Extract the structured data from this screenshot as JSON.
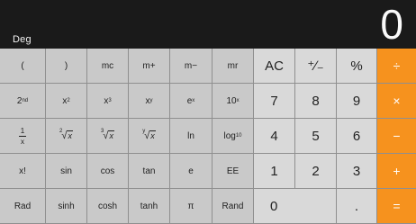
{
  "display": {
    "mode": "Deg",
    "value": "0"
  },
  "rows": [
    [
      {
        "id": "open-paren",
        "label": "(",
        "kind": "sci"
      },
      {
        "id": "close-paren",
        "label": ")",
        "kind": "sci"
      },
      {
        "id": "mc",
        "label": "mc",
        "kind": "sci"
      },
      {
        "id": "m-plus",
        "label": "m+",
        "kind": "sci"
      },
      {
        "id": "m-minus",
        "label": "m−",
        "kind": "sci"
      },
      {
        "id": "mr",
        "label": "mr",
        "kind": "sci"
      },
      {
        "id": "ac",
        "label": "AC",
        "kind": "num"
      },
      {
        "id": "plus-minus",
        "label": "⁺∕₋",
        "kind": "num"
      },
      {
        "id": "percent",
        "label": "%",
        "kind": "num"
      },
      {
        "id": "divide",
        "label": "÷",
        "kind": "op"
      }
    ],
    [
      {
        "id": "second",
        "label": "2",
        "sup": "nd",
        "kind": "sci"
      },
      {
        "id": "x-squared",
        "label": "x",
        "sup": "2",
        "kind": "sci"
      },
      {
        "id": "x-cubed",
        "label": "x",
        "sup": "3",
        "kind": "sci"
      },
      {
        "id": "x-pow-y",
        "label": "x",
        "sup": "y",
        "kind": "sci"
      },
      {
        "id": "e-pow-x",
        "label": "e",
        "sup": "x",
        "kind": "sci"
      },
      {
        "id": "ten-pow-x",
        "label": "10",
        "sup": "x",
        "kind": "sci"
      },
      {
        "id": "digit-7",
        "label": "7",
        "kind": "num"
      },
      {
        "id": "digit-8",
        "label": "8",
        "kind": "num"
      },
      {
        "id": "digit-9",
        "label": "9",
        "kind": "num"
      },
      {
        "id": "multiply",
        "label": "×",
        "kind": "op"
      }
    ],
    [
      {
        "id": "reciprocal",
        "label": "",
        "kind": "sci",
        "frac": {
          "num": "1",
          "den": "x"
        }
      },
      {
        "id": "sqrt",
        "label": "",
        "kind": "sci",
        "rad": {
          "idx": "2",
          "arg": "x"
        }
      },
      {
        "id": "cbrt",
        "label": "",
        "kind": "sci",
        "rad": {
          "idx": "3",
          "arg": "x"
        }
      },
      {
        "id": "yroot",
        "label": "",
        "kind": "sci",
        "rad": {
          "idx": "y",
          "arg": "x"
        }
      },
      {
        "id": "ln",
        "label": "ln",
        "kind": "sci"
      },
      {
        "id": "log10",
        "label": "log",
        "sub": "10",
        "kind": "sci"
      },
      {
        "id": "digit-4",
        "label": "4",
        "kind": "num"
      },
      {
        "id": "digit-5",
        "label": "5",
        "kind": "num"
      },
      {
        "id": "digit-6",
        "label": "6",
        "kind": "num"
      },
      {
        "id": "subtract",
        "label": "−",
        "kind": "op"
      }
    ],
    [
      {
        "id": "factorial",
        "label": "x!",
        "kind": "sci"
      },
      {
        "id": "sin",
        "label": "sin",
        "kind": "sci"
      },
      {
        "id": "cos",
        "label": "cos",
        "kind": "sci"
      },
      {
        "id": "tan",
        "label": "tan",
        "kind": "sci"
      },
      {
        "id": "e-const",
        "label": "e",
        "kind": "sci"
      },
      {
        "id": "ee",
        "label": "EE",
        "kind": "sci"
      },
      {
        "id": "digit-1",
        "label": "1",
        "kind": "num"
      },
      {
        "id": "digit-2",
        "label": "2",
        "kind": "num"
      },
      {
        "id": "digit-3",
        "label": "3",
        "kind": "num"
      },
      {
        "id": "add",
        "label": "+",
        "kind": "op"
      }
    ],
    [
      {
        "id": "rad",
        "label": "Rad",
        "kind": "sci"
      },
      {
        "id": "sinh",
        "label": "sinh",
        "kind": "sci"
      },
      {
        "id": "cosh",
        "label": "cosh",
        "kind": "sci"
      },
      {
        "id": "tanh",
        "label": "tanh",
        "kind": "sci"
      },
      {
        "id": "pi",
        "label": "π",
        "kind": "sci"
      },
      {
        "id": "rand",
        "label": "Rand",
        "kind": "sci"
      },
      {
        "id": "digit-0",
        "label": "0",
        "kind": "num",
        "wide": true
      },
      {
        "id": "decimal",
        "label": ".",
        "kind": "num"
      },
      {
        "id": "equals",
        "label": "=",
        "kind": "op"
      }
    ]
  ]
}
